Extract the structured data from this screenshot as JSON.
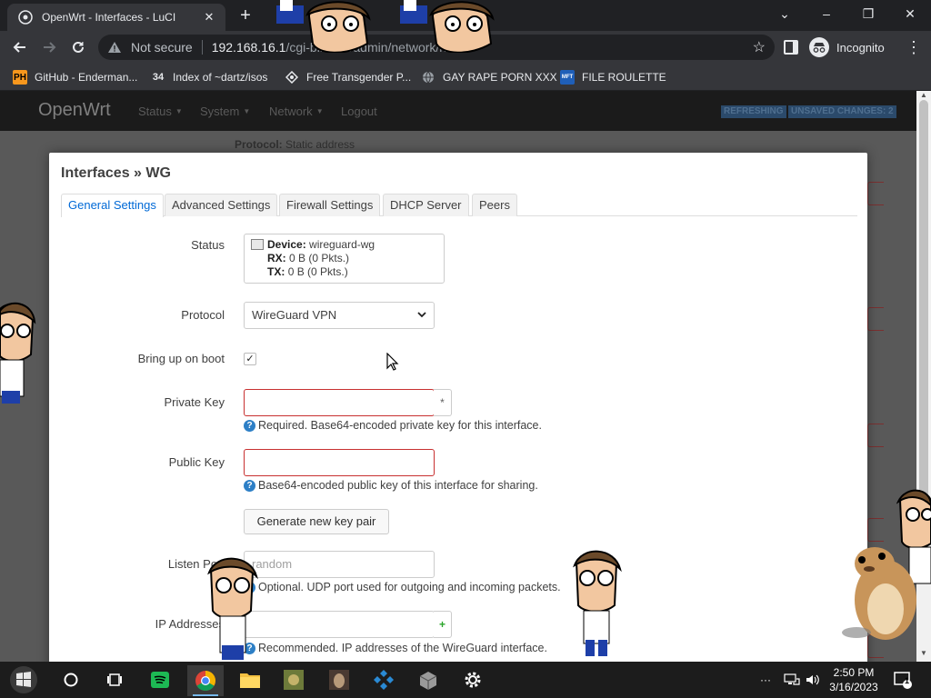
{
  "browser": {
    "tab_title": "OpenWrt - Interfaces - LuCI",
    "tab_close": "✕",
    "new_tab": "+",
    "window_controls": {
      "chevron": "⌄",
      "minimize": "–",
      "restore": "❐",
      "close": "✕"
    },
    "security_label": "Not secure",
    "url_host": "192.168.16.1",
    "url_path": "/cgi-bin/luci/admin/network/netw",
    "profile_label": "Incognito",
    "bookmarks": [
      {
        "label": "GitHub - Enderman...",
        "icon": "pornhub-icon",
        "icon_text": "PH"
      },
      {
        "label": "Index of ~dartz/isos",
        "icon": "number-icon",
        "icon_text": "34"
      },
      {
        "label": "Free Transgender P...",
        "icon": "site-icon",
        "icon_text": ""
      },
      {
        "label": "GAY RAPE PORN XXX",
        "icon": "globe-icon",
        "icon_text": ""
      },
      {
        "label": "FILE ROULETTE",
        "icon": "file-roulette-icon",
        "icon_text": "MFT"
      }
    ]
  },
  "openwrt": {
    "brand": "OpenWrt",
    "menu": [
      "Status",
      "System",
      "Network",
      "Logout"
    ],
    "indicators": [
      "REFRESHING",
      "UNSAVED CHANGES: 2"
    ],
    "background_protocol_label": "Protocol:",
    "background_protocol_value": "Static address"
  },
  "modal": {
    "title": "Interfaces » WG",
    "tabs": [
      "General Settings",
      "Advanced Settings",
      "Firewall Settings",
      "DHCP Server",
      "Peers"
    ],
    "active_tab": "General Settings",
    "labels": {
      "status": "Status",
      "protocol": "Protocol",
      "boot": "Bring up on boot",
      "private_key": "Private Key",
      "public_key": "Public Key",
      "listen_port": "Listen Port",
      "ip_addresses": "IP Addresses"
    },
    "status": {
      "device_label": "Device:",
      "device_value": "wireguard-wg",
      "rx_label": "RX:",
      "rx_value": "0 B (0 Pkts.)",
      "tx_label": "TX:",
      "tx_value": "0 B (0 Pkts.)"
    },
    "protocol_value": "WireGuard VPN",
    "boot_checked": true,
    "private_key_value": "",
    "private_key_toggle": "*",
    "private_key_hint": "Required. Base64-encoded private key for this interface.",
    "public_key_value": "",
    "public_key_hint": "Base64-encoded public key of this interface for sharing.",
    "generate_button": "Generate new key pair",
    "listen_port_placeholder": "random",
    "listen_port_hint": "Optional. UDP port used for outgoing and incoming packets.",
    "ip_add_button": "+",
    "ip_hint": "Recommended. IP addresses of the WireGuard interface."
  },
  "taskbar": {
    "time": "2:50 PM",
    "date": "3/16/2023",
    "notification_count": "1",
    "apps": [
      "start",
      "search",
      "task-view",
      "spotify",
      "chrome",
      "file-explorer",
      "app-1",
      "app-2",
      "app-3",
      "app-4",
      "settings"
    ]
  },
  "colors": {
    "accent": "#0069d6",
    "invalid": "#c83030",
    "hint_icon": "#2d7fc6"
  }
}
